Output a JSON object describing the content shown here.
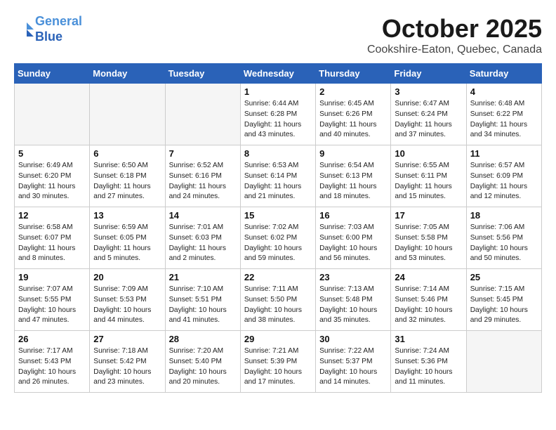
{
  "header": {
    "logo_line1": "General",
    "logo_line2": "Blue",
    "month": "October 2025",
    "location": "Cookshire-Eaton, Quebec, Canada"
  },
  "weekdays": [
    "Sunday",
    "Monday",
    "Tuesday",
    "Wednesday",
    "Thursday",
    "Friday",
    "Saturday"
  ],
  "weeks": [
    [
      {
        "day": "",
        "content": ""
      },
      {
        "day": "",
        "content": ""
      },
      {
        "day": "",
        "content": ""
      },
      {
        "day": "1",
        "content": "Sunrise: 6:44 AM\nSunset: 6:28 PM\nDaylight: 11 hours\nand 43 minutes."
      },
      {
        "day": "2",
        "content": "Sunrise: 6:45 AM\nSunset: 6:26 PM\nDaylight: 11 hours\nand 40 minutes."
      },
      {
        "day": "3",
        "content": "Sunrise: 6:47 AM\nSunset: 6:24 PM\nDaylight: 11 hours\nand 37 minutes."
      },
      {
        "day": "4",
        "content": "Sunrise: 6:48 AM\nSunset: 6:22 PM\nDaylight: 11 hours\nand 34 minutes."
      }
    ],
    [
      {
        "day": "5",
        "content": "Sunrise: 6:49 AM\nSunset: 6:20 PM\nDaylight: 11 hours\nand 30 minutes."
      },
      {
        "day": "6",
        "content": "Sunrise: 6:50 AM\nSunset: 6:18 PM\nDaylight: 11 hours\nand 27 minutes."
      },
      {
        "day": "7",
        "content": "Sunrise: 6:52 AM\nSunset: 6:16 PM\nDaylight: 11 hours\nand 24 minutes."
      },
      {
        "day": "8",
        "content": "Sunrise: 6:53 AM\nSunset: 6:14 PM\nDaylight: 11 hours\nand 21 minutes."
      },
      {
        "day": "9",
        "content": "Sunrise: 6:54 AM\nSunset: 6:13 PM\nDaylight: 11 hours\nand 18 minutes."
      },
      {
        "day": "10",
        "content": "Sunrise: 6:55 AM\nSunset: 6:11 PM\nDaylight: 11 hours\nand 15 minutes."
      },
      {
        "day": "11",
        "content": "Sunrise: 6:57 AM\nSunset: 6:09 PM\nDaylight: 11 hours\nand 12 minutes."
      }
    ],
    [
      {
        "day": "12",
        "content": "Sunrise: 6:58 AM\nSunset: 6:07 PM\nDaylight: 11 hours\nand 8 minutes."
      },
      {
        "day": "13",
        "content": "Sunrise: 6:59 AM\nSunset: 6:05 PM\nDaylight: 11 hours\nand 5 minutes."
      },
      {
        "day": "14",
        "content": "Sunrise: 7:01 AM\nSunset: 6:03 PM\nDaylight: 11 hours\nand 2 minutes."
      },
      {
        "day": "15",
        "content": "Sunrise: 7:02 AM\nSunset: 6:02 PM\nDaylight: 10 hours\nand 59 minutes."
      },
      {
        "day": "16",
        "content": "Sunrise: 7:03 AM\nSunset: 6:00 PM\nDaylight: 10 hours\nand 56 minutes."
      },
      {
        "day": "17",
        "content": "Sunrise: 7:05 AM\nSunset: 5:58 PM\nDaylight: 10 hours\nand 53 minutes."
      },
      {
        "day": "18",
        "content": "Sunrise: 7:06 AM\nSunset: 5:56 PM\nDaylight: 10 hours\nand 50 minutes."
      }
    ],
    [
      {
        "day": "19",
        "content": "Sunrise: 7:07 AM\nSunset: 5:55 PM\nDaylight: 10 hours\nand 47 minutes."
      },
      {
        "day": "20",
        "content": "Sunrise: 7:09 AM\nSunset: 5:53 PM\nDaylight: 10 hours\nand 44 minutes."
      },
      {
        "day": "21",
        "content": "Sunrise: 7:10 AM\nSunset: 5:51 PM\nDaylight: 10 hours\nand 41 minutes."
      },
      {
        "day": "22",
        "content": "Sunrise: 7:11 AM\nSunset: 5:50 PM\nDaylight: 10 hours\nand 38 minutes."
      },
      {
        "day": "23",
        "content": "Sunrise: 7:13 AM\nSunset: 5:48 PM\nDaylight: 10 hours\nand 35 minutes."
      },
      {
        "day": "24",
        "content": "Sunrise: 7:14 AM\nSunset: 5:46 PM\nDaylight: 10 hours\nand 32 minutes."
      },
      {
        "day": "25",
        "content": "Sunrise: 7:15 AM\nSunset: 5:45 PM\nDaylight: 10 hours\nand 29 minutes."
      }
    ],
    [
      {
        "day": "26",
        "content": "Sunrise: 7:17 AM\nSunset: 5:43 PM\nDaylight: 10 hours\nand 26 minutes."
      },
      {
        "day": "27",
        "content": "Sunrise: 7:18 AM\nSunset: 5:42 PM\nDaylight: 10 hours\nand 23 minutes."
      },
      {
        "day": "28",
        "content": "Sunrise: 7:20 AM\nSunset: 5:40 PM\nDaylight: 10 hours\nand 20 minutes."
      },
      {
        "day": "29",
        "content": "Sunrise: 7:21 AM\nSunset: 5:39 PM\nDaylight: 10 hours\nand 17 minutes."
      },
      {
        "day": "30",
        "content": "Sunrise: 7:22 AM\nSunset: 5:37 PM\nDaylight: 10 hours\nand 14 minutes."
      },
      {
        "day": "31",
        "content": "Sunrise: 7:24 AM\nSunset: 5:36 PM\nDaylight: 10 hours\nand 11 minutes."
      },
      {
        "day": "",
        "content": ""
      }
    ]
  ]
}
